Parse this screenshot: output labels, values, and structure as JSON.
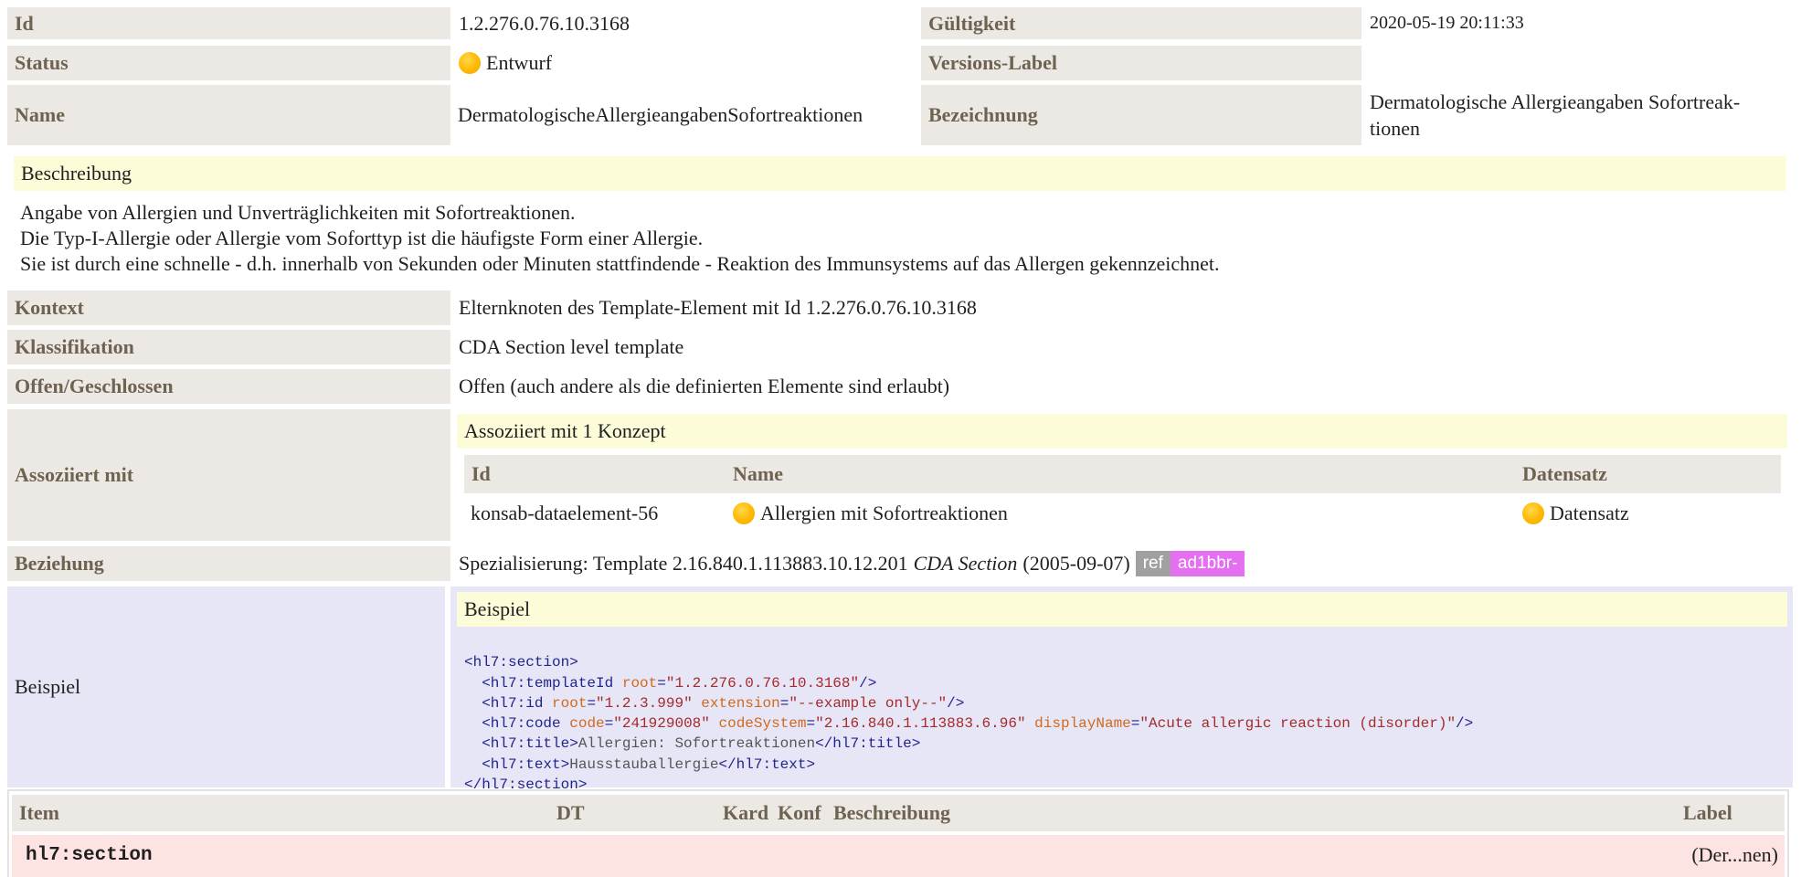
{
  "header": {
    "id_label": "Id",
    "id_value": "1.2.276.0.76.10.3168",
    "valid_label": "Gültigkeit",
    "valid_value": "2020-05-19 20:11:33",
    "status_label": "Status",
    "status_value": "Entwurf",
    "version_label": "Versions-Label",
    "version_value": "",
    "name_label": "Name",
    "name_value": "DermatologischeAllergieangabenSofortreaktionen",
    "designation_label": "Bezeichnung",
    "designation_line1": "Dermatologische Allergieangaben Sofortreak-",
    "designation_line2": "tionen"
  },
  "description": {
    "label": "Beschreibung",
    "line1": "Angabe von Allergien und Unverträglichkeiten mit Sofortreaktionen.",
    "line2": "Die Typ-I-Allergie oder Allergie vom Soforttyp ist die häufigste Form einer Allergie.",
    "line3": "Sie ist durch eine schnelle - d.h. innerhalb von Sekunden oder Minuten stattfindende - Reaktion des Immunsystems auf das Allergen gekennzeichnet."
  },
  "context": {
    "label": "Kontext",
    "value": "Elternknoten des Template-Element mit Id 1.2.276.0.76.10.3168"
  },
  "classification": {
    "label": "Klassifikation",
    "value": "CDA Section level template"
  },
  "openness": {
    "label": "Offen/Geschlossen",
    "value": "Offen (auch andere als die definierten Elemente sind erlaubt)"
  },
  "associated": {
    "label": "Assoziiert mit",
    "title": "Assoziiert mit 1 Konzept",
    "col_id": "Id",
    "col_name": "Name",
    "col_dataset": "Datensatz",
    "row_id": "konsab-dataelement-56",
    "row_name": "Allergien mit Sofortreaktionen",
    "row_dataset": "Datensatz"
  },
  "relationship": {
    "label": "Beziehung",
    "prefix": "Spezialisierung: Template 2.16.840.1.113883.10.12.201",
    "italic": "CDA Section",
    "date": "(2005-09-07)",
    "ref_badge": "ref",
    "id_badge": "ad1bbr-"
  },
  "example": {
    "label": "Beispiel",
    "title": "Beispiel",
    "l1_tag": "<hl7:section>",
    "l2_tag_open": "  <hl7:templateId",
    "l2_attr1": "root",
    "l2_val1": "\"1.2.276.0.76.10.3168\"",
    "l2_end": "/>",
    "l3_tag_open": "  <hl7:id",
    "l3_attr1": "root",
    "l3_val1": "\"1.2.3.999\"",
    "l3_attr2": "extension",
    "l3_val2": "\"--example only--\"",
    "l3_end": "/>",
    "l4_tag_open": "  <hl7:code",
    "l4_attr1": "code",
    "l4_val1": "\"241929008\"",
    "l4_attr2": "codeSystem",
    "l4_val2": "\"2.16.840.1.113883.6.96\"",
    "l4_attr3": "displayName",
    "l4_val3": "\"Acute allergic reaction (disorder)\"",
    "l4_end": "/>",
    "l5_tag_open": "  <hl7:title>",
    "l5_text": "Allergien: Sofortreaktionen",
    "l5_tag_close": "</hl7:title>",
    "l6_tag_open": "  <hl7:text>",
    "l6_text": "Hausstauballergie",
    "l6_tag_close": "</hl7:text>",
    "l7_tag": "</hl7:section>"
  },
  "items_table": {
    "col_item": "Item",
    "col_dt": "DT",
    "col_kard": "Kard",
    "col_konf": "Konf",
    "col_desc": "Beschreibung",
    "col_label": "Label",
    "row_item": "hl7:section",
    "row_label": "(Der...nen)"
  }
}
